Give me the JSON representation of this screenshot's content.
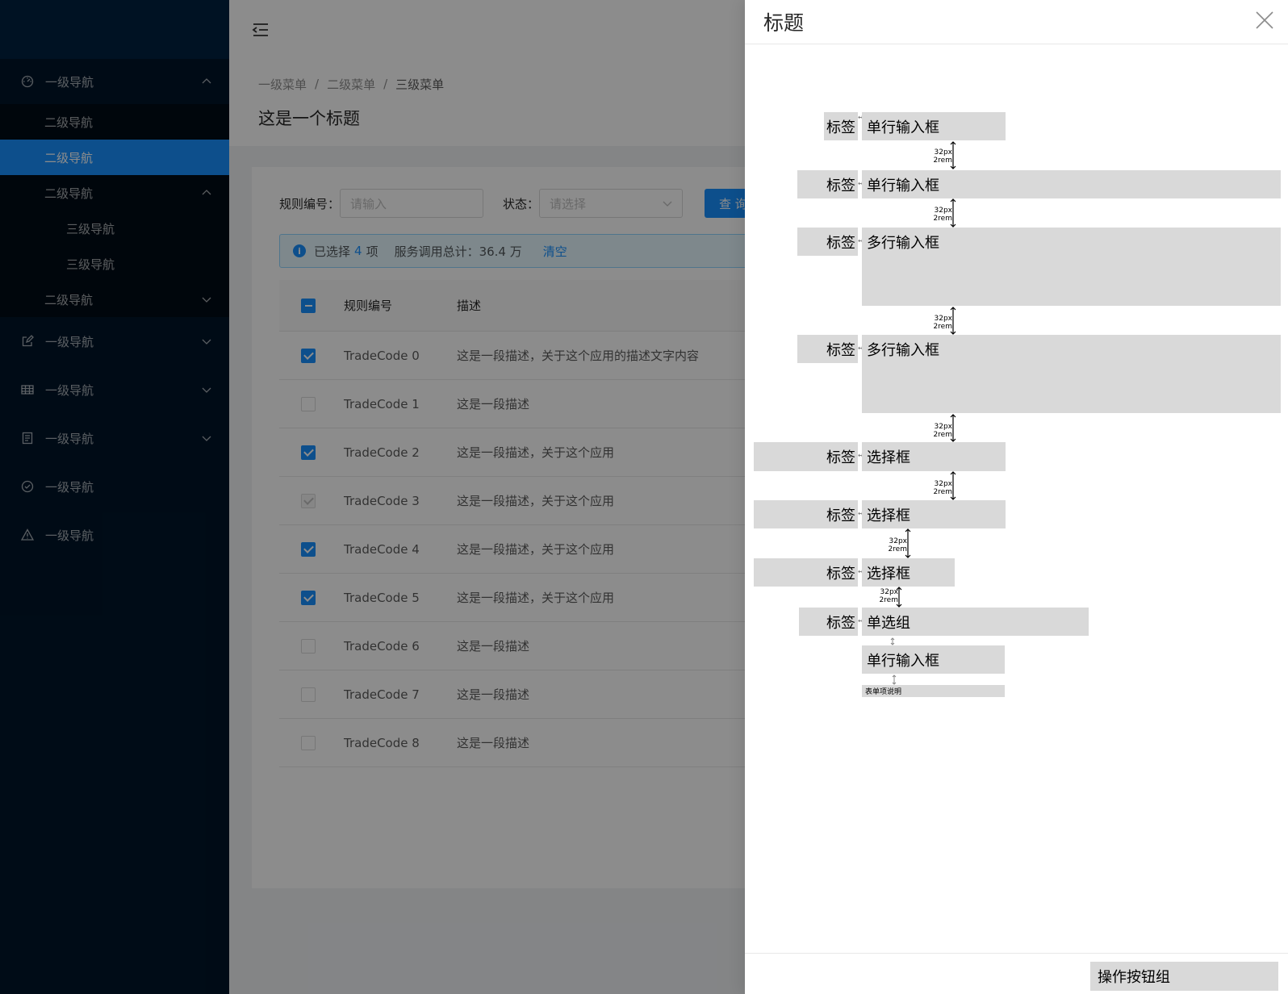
{
  "sidebar": {
    "items": [
      {
        "label": "一级导航",
        "icon": "dashboard-icon",
        "expanded": true,
        "children": [
          {
            "label": "二级导航"
          },
          {
            "label": "二级导航",
            "active": true
          },
          {
            "label": "二级导航",
            "expanded": true,
            "children": [
              {
                "label": "三级导航"
              },
              {
                "label": "三级导航"
              }
            ]
          },
          {
            "label": "二级导航",
            "expanded": false
          }
        ]
      },
      {
        "label": "一级导航",
        "icon": "edit-icon"
      },
      {
        "label": "一级导航",
        "icon": "table-icon"
      },
      {
        "label": "一级导航",
        "icon": "profile-icon"
      },
      {
        "label": "一级导航",
        "icon": "check-circle-icon"
      },
      {
        "label": "一级导航",
        "icon": "warning-icon"
      }
    ]
  },
  "breadcrumb": [
    "一级菜单",
    "二级菜单",
    "三级菜单"
  ],
  "breadcrumb_sep": "/",
  "page_title": "这是一个标题",
  "search": {
    "rule_label": "规则编号：",
    "rule_placeholder": "请输入",
    "status_label": "状态：",
    "status_placeholder": "请选择",
    "query_button": "查 询"
  },
  "alert": {
    "prefix": "已选择",
    "count": "4",
    "suffix": "项",
    "total_text": "服务调用总计：36.4 万",
    "clear": "清空"
  },
  "table": {
    "columns": [
      "规则编号",
      "描述"
    ],
    "rows": [
      {
        "code": "TradeCode 0",
        "desc": "这是一段描述，关于这个应用的描述文字内容",
        "state": "checked"
      },
      {
        "code": "TradeCode 1",
        "desc": "这是一段描述",
        "state": "unchecked"
      },
      {
        "code": "TradeCode 2",
        "desc": "这是一段描述，关于这个应用",
        "state": "checked"
      },
      {
        "code": "TradeCode 3",
        "desc": "这是一段描述，关于这个应用",
        "state": "disabled"
      },
      {
        "code": "TradeCode 4",
        "desc": "这是一段描述，关于这个应用",
        "state": "checked"
      },
      {
        "code": "TradeCode 5",
        "desc": "这是一段描述，关于这个应用",
        "state": "checked"
      },
      {
        "code": "TradeCode 6",
        "desc": "这是一段描述",
        "state": "unchecked"
      },
      {
        "code": "TradeCode 7",
        "desc": "这是一段描述",
        "state": "unchecked"
      },
      {
        "code": "TradeCode 8",
        "desc": "这是一段描述",
        "state": "unchecked"
      }
    ]
  },
  "drawer": {
    "title": "标题",
    "close_icon": "close-icon",
    "form": {
      "label": "标签",
      "single_input": "单行输入框",
      "multi_input": "多行输入框",
      "select": "选择框",
      "radio_group": "单选组",
      "help_text": "表单项说明",
      "spacing_px": "32px",
      "spacing_rem": "2rem"
    },
    "footer_button": "操作按钮组"
  },
  "colors": {
    "sidebar_bg": "#001529",
    "primary": "#1890ff",
    "placeholder_block": "#d9d9d9"
  }
}
